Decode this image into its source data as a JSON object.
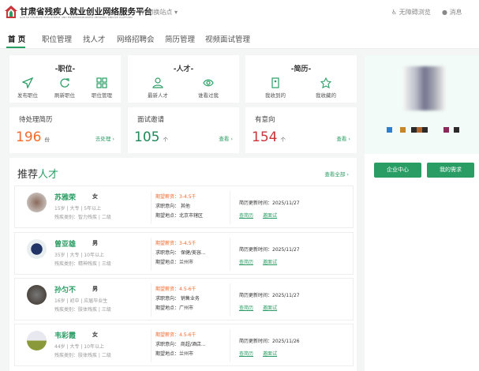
{
  "header": {
    "brand": "甘肃省残疾人就业创业网络服务平台",
    "brand_en": "GAN SU DISABLED EMPLOYMENT AND ENTREPRENEURSHIP NETWORK SERVICE PLATFORM",
    "switch_site": "切换站点",
    "accessibility": "无障碍浏览",
    "messages": "消息"
  },
  "nav": [
    "首 页",
    "职位管理",
    "找人才",
    "网络招聘会",
    "简历管理",
    "视频面试管理"
  ],
  "quick": [
    {
      "title": "-职位-",
      "items": [
        "发布职位",
        "刷新职位",
        "职位管理"
      ]
    },
    {
      "title": "-人才-",
      "items": [
        "最新人才",
        "谁看过我"
      ]
    },
    {
      "title": "-简历-",
      "items": [
        "我收到的",
        "我收藏的"
      ]
    }
  ],
  "stats": [
    {
      "label": "待处理简历",
      "value": "196",
      "unit": "份",
      "action": "去处理",
      "color": "#f26a2c"
    },
    {
      "label": "面试邀请",
      "value": "105",
      "unit": "个",
      "action": "查看",
      "color": "#1f8a57"
    },
    {
      "label": "有意向",
      "value": "154",
      "unit": "个",
      "action": "查看",
      "color": "#c8353a"
    }
  ],
  "recommend": {
    "title_a": "推荐",
    "title_b": "人才",
    "view_all": "查看全部 ›",
    "rows": [
      {
        "name": "苏雅荣",
        "gender": "女",
        "info": "15岁 | 大专 | 5年以上",
        "disability": "残疾类别：智力残疾 | 二级",
        "salary": "期望薪资：3-4.5千",
        "intent": "求职意向：  其他",
        "place": "期望地点：北京市辖区",
        "updated": "简历更新时间：2025/11/27",
        "view": "查简历",
        "invite": "邀面试"
      },
      {
        "name": "曾亚雄",
        "gender": "男",
        "info": "35岁 | 大专 | 10年以上",
        "disability": "残疾类别：精神残疾 | 三级",
        "salary": "期望薪资：3-4.5千",
        "intent": "求职意向：  保健/美容...",
        "place": "期望地点：兰州市",
        "updated": "简历更新时间：2025/11/27",
        "view": "查简历",
        "invite": "邀面试"
      },
      {
        "name": "孙匀不",
        "gender": "男",
        "info": "16岁 | 初中 | 应届毕业生",
        "disability": "残疾类别：肢体残疾 | 三级",
        "salary": "期望薪资：4.5-6千",
        "intent": "求职意向：  销售业务",
        "place": "期望地点：广州市",
        "updated": "简历更新时间：2025/11/27",
        "view": "查简历",
        "invite": "邀面试"
      },
      {
        "name": "韦彩霞",
        "gender": "女",
        "info": "44岁 | 大专 | 10年以上",
        "disability": "残疾类别：肢体残疾 | 二级",
        "salary": "期望薪资：4.5-6千",
        "intent": "求职意向：  商超/酒店...",
        "place": "期望地点：兰州市",
        "updated": "简历更新时间：2025/11/26",
        "view": "查简历",
        "invite": "邀面试"
      }
    ]
  },
  "side": {
    "btn1": "企业中心",
    "btn2": "我的需求",
    "swatches": [
      "#2f7fcf",
      "#c8862a",
      "#2a2a2a",
      "#b5652a",
      "#2a2a2a",
      "#8a2a5a",
      "#2a2a2a"
    ]
  },
  "colors": {
    "accent": "#2a9d64",
    "salary": "#f26a2c"
  }
}
